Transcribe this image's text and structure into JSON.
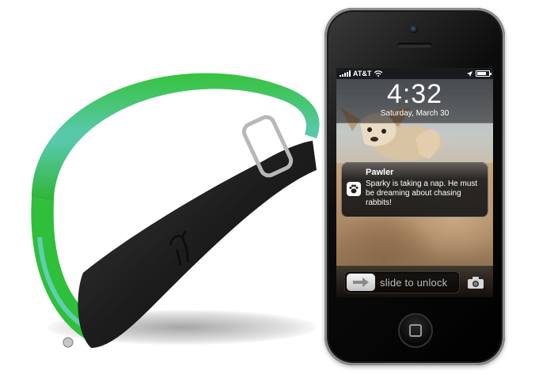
{
  "phone": {
    "status_bar": {
      "carrier": "AT&T",
      "icons": [
        "signal-icon",
        "wifi-icon",
        "location-icon",
        "battery-icon"
      ]
    },
    "lock_screen": {
      "time": "4:32",
      "date": "Saturday, March 30"
    },
    "notification": {
      "app_name": "Pawler",
      "icon": "paw-icon",
      "message": "Sparky is taking a nap. He must be dreaming about chasing rabbits!"
    },
    "unlock": {
      "label": "slide to unlock",
      "knob_icon": "arrow-right-icon",
      "camera_icon": "camera-icon"
    }
  },
  "product": {
    "collar_colors": [
      "#2fbf3a",
      "#56c2a6",
      "#1b1b1b"
    ]
  }
}
